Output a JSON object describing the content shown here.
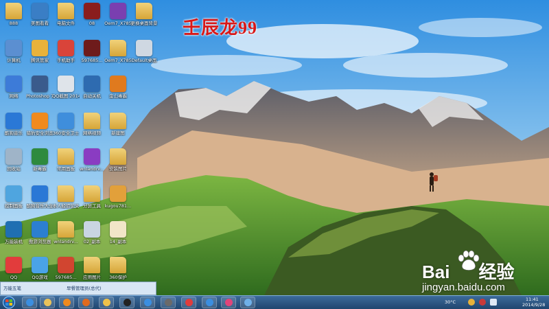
{
  "overlay": {
    "watermark": "壬辰龙99",
    "baidu_logo": "Bai",
    "baidu_logo_suffix": "经验",
    "baidu_subtitle": "jingyan.baidu.com"
  },
  "desktop": {
    "icons": [
      {
        "label": "888",
        "color": "#e2b44a"
      },
      {
        "label": "计算机",
        "color": "#5b8fd1"
      },
      {
        "label": "网络",
        "color": "#3d7bd8"
      },
      {
        "label": "酷狗音乐",
        "color": "#2a78d6"
      },
      {
        "label": "回收站",
        "color": "#9fb4c8"
      },
      {
        "label": "控制面板",
        "color": "#4fa5df"
      },
      {
        "label": "万能装机",
        "color": "#1f6fb2"
      },
      {
        "label": "QQ",
        "color": "#e23c3c"
      },
      {
        "label": "美图看看",
        "color": "#3a7ec5"
      },
      {
        "label": "腾讯管家",
        "color": "#e8b23a"
      },
      {
        "label": "Photoshop 7.0",
        "color": "#3a5b8c"
      },
      {
        "label": "猎豹安全浏览",
        "color": "#f08a1e"
      },
      {
        "label": "新毒霸",
        "color": "#2e8a3e"
      },
      {
        "label": "酷狗音乐大全",
        "color": "#2a78d6"
      },
      {
        "label": "傲游浏览器",
        "color": "#2c7fd0"
      },
      {
        "label": "QQ游戏",
        "color": "#4aa3e8"
      },
      {
        "label": "电脑文件",
        "color": "#e2b44a"
      },
      {
        "label": "手机助手",
        "color": "#d9443a"
      },
      {
        "label": "QQ截图 20140926",
        "color": "#dfe4ea"
      },
      {
        "label": "360安全卫士",
        "color": "#3f8edc"
      },
      {
        "label": "常用面板",
        "color": "#e2b44a"
      },
      {
        "label": "本人经验论文",
        "color": "#e2b44a"
      },
      {
        "label": "wnlandrv...",
        "color": "#e2b44a"
      },
      {
        "label": "597685...",
        "color": "#d14530"
      },
      {
        "label": "08",
        "color": "#8a1d1d"
      },
      {
        "label": "597685...",
        "color": "#6e1b1b"
      },
      {
        "label": "自动关机",
        "color": "#2e6bb0"
      },
      {
        "label": "网络视频",
        "color": "#e2b44a"
      },
      {
        "label": "wnlandrv...",
        "color": "#8a3cc2"
      },
      {
        "label": "分屏工具",
        "color": "#e2b44a"
      },
      {
        "label": "02_副本",
        "color": "#c9d5e2"
      },
      {
        "label": "应用图片",
        "color": "#e2b44a"
      },
      {
        "label": "Oem7_X785",
        "color": "#7a3fb0"
      },
      {
        "label": "Oem7_X785",
        "color": "#e2b44a"
      },
      {
        "label": "金山毒霸",
        "color": "#e07a1e"
      },
      {
        "label": "新建图",
        "color": "#e2b44a"
      },
      {
        "label": "安装图片",
        "color": "#e2b44a"
      },
      {
        "label": "kugou781...",
        "color": "#e2a03a"
      },
      {
        "label": "14_副本",
        "color": "#f1e6c8"
      },
      {
        "label": "360保护",
        "color": "#e2b44a"
      },
      {
        "label": "更换桌面背景",
        "color": "#e2b44a"
      },
      {
        "label": "Default桌面",
        "color": "#cfd8e2"
      }
    ]
  },
  "mini_window": {
    "title": "万能五笔",
    "tab": "早餐管理员(总代)"
  },
  "taskbar": {
    "start_icon": "windows-logo-icon",
    "pinned": [
      {
        "name": "ie-icon",
        "color": "#3b8ee0"
      },
      {
        "name": "explorer-icon",
        "color": "#e9c25a"
      },
      {
        "name": "media-player-icon",
        "color": "#ef8a1e"
      },
      {
        "name": "firefox-icon",
        "color": "#e06a1e"
      },
      {
        "name": "baofeng-icon",
        "color": "#f0c24a"
      },
      {
        "name": "qq-icon",
        "color": "#222222"
      },
      {
        "name": "music-icon",
        "color": "#3b8ee0"
      },
      {
        "name": "photo-icon",
        "color": "#6a6a6a"
      },
      {
        "name": "app-red-icon",
        "color": "#e03c3c"
      },
      {
        "name": "app-blue-icon",
        "color": "#3b8ee0"
      },
      {
        "name": "app-pink-icon",
        "color": "#e0457a"
      },
      {
        "name": "app-screen-icon",
        "color": "#6fb0e8"
      }
    ],
    "tray": {
      "temperature": "30°C",
      "time": "11:41",
      "date": "2014/9/28"
    }
  }
}
